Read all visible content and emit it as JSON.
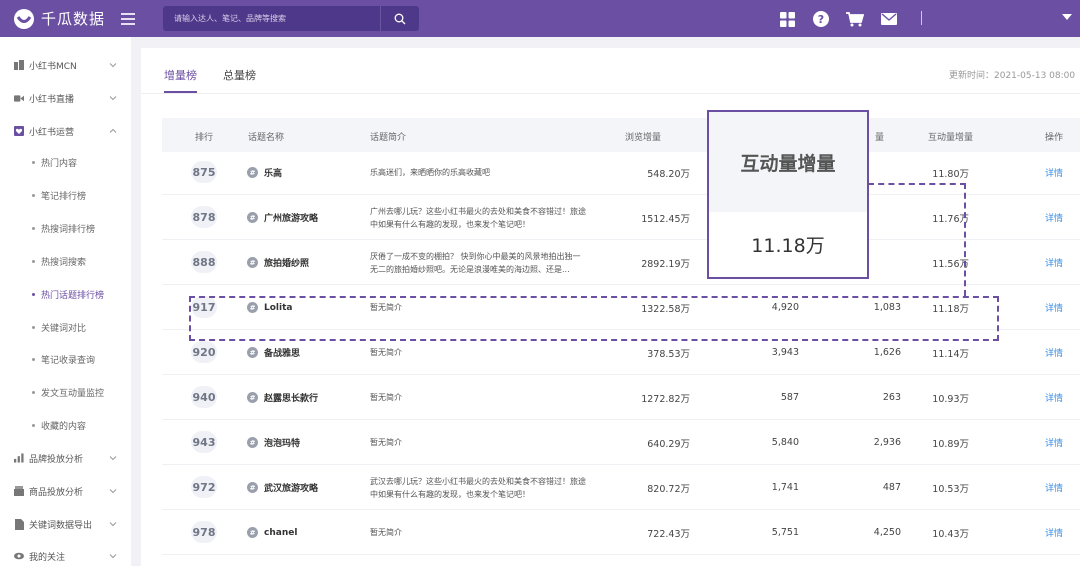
{
  "app": {
    "name": "千瓜数据",
    "search_placeholder": "请输入达人、笔记、品牌等搜索"
  },
  "top_icons": [
    "grid-icon",
    "help-icon",
    "cart-icon",
    "mail-icon"
  ],
  "sidebar": {
    "items": [
      {
        "label": "小红书MCN",
        "icon": "building-icon"
      },
      {
        "label": "小红书直播",
        "icon": "video-icon"
      },
      {
        "label": "小红书运营",
        "icon": "heart-box-icon"
      }
    ],
    "sub_items": [
      {
        "label": "热门内容",
        "active": false
      },
      {
        "label": "笔记排行榜",
        "active": false
      },
      {
        "label": "热搜词排行榜",
        "active": false
      },
      {
        "label": "热搜词搜索",
        "active": false
      },
      {
        "label": "热门话题排行榜",
        "active": true
      },
      {
        "label": "关键词对比",
        "active": false
      },
      {
        "label": "笔记收录查询",
        "active": false
      },
      {
        "label": "发文互动量监控",
        "active": false
      },
      {
        "label": "收藏的内容",
        "active": false
      }
    ],
    "bottom_items": [
      {
        "label": "品牌投放分析",
        "icon": "chart-icon"
      },
      {
        "label": "商品投放分析",
        "icon": "shop-icon"
      },
      {
        "label": "关键词数据导出",
        "icon": "export-icon"
      },
      {
        "label": "我的关注",
        "icon": "eye-icon"
      }
    ]
  },
  "tabs": [
    {
      "label": "增量榜",
      "active": true
    },
    {
      "label": "总量榜",
      "active": false
    }
  ],
  "update_time": "更新时间：2021-05-13 08:00",
  "table": {
    "headers": [
      "排行",
      "话题名称",
      "话题简介",
      "浏览增量",
      "",
      "量",
      "互动量增量",
      "操作"
    ],
    "rows": [
      {
        "rank": "875",
        "topic": "乐高",
        "desc": "乐高迷们，来晒晒你的乐高收藏吧",
        "views": "548.20万",
        "c2": "",
        "c3": "",
        "interact": "11.80万",
        "action": "详情"
      },
      {
        "rank": "878",
        "topic": "广州旅游攻略",
        "desc": "广州去哪儿玩？这些小红书最火的去处和美食不容错过！旅途中如果有什么有趣的发现，也来发个笔记吧！",
        "views": "1512.45万",
        "c2": "",
        "c3": "",
        "interact": "11.76万",
        "action": "详情"
      },
      {
        "rank": "888",
        "topic": "旅拍婚纱照",
        "desc": "厌倦了一成不变的棚拍？ 快到你心中最美的风景地拍出独一无二的旅拍婚纱照吧。无论是浪漫唯美的海边照、还是...",
        "views": "2892.19万",
        "c2": "",
        "c3": "",
        "interact": "11.56万",
        "action": "详情"
      },
      {
        "rank": "917",
        "topic": "Lolita",
        "desc": "暂无简介",
        "views": "1322.58万",
        "c2": "4,920",
        "c3": "1,083",
        "interact": "11.18万",
        "action": "详情"
      },
      {
        "rank": "920",
        "topic": "备战雅思",
        "desc": "暂无简介",
        "views": "378.53万",
        "c2": "3,943",
        "c3": "1,626",
        "interact": "11.14万",
        "action": "详情"
      },
      {
        "rank": "940",
        "topic": "赵露思长款行",
        "desc": "暂无简介",
        "views": "1272.82万",
        "c2": "587",
        "c3": "263",
        "interact": "10.93万",
        "action": "详情"
      },
      {
        "rank": "943",
        "topic": "泡泡玛特",
        "desc": "暂无简介",
        "views": "640.29万",
        "c2": "5,840",
        "c3": "2,936",
        "interact": "10.89万",
        "action": "详情"
      },
      {
        "rank": "972",
        "topic": "武汉旅游攻略",
        "desc": "武汉去哪儿玩？这些小红书最火的去处和美食不容错过！旅途中如果有什么有趣的发现，也来发个笔记吧！",
        "views": "820.72万",
        "c2": "1,741",
        "c3": "487",
        "interact": "10.53万",
        "action": "详情"
      },
      {
        "rank": "978",
        "topic": "chanel",
        "desc": "暂无简介",
        "views": "722.43万",
        "c2": "5,751",
        "c3": "4,250",
        "interact": "10.43万",
        "action": "详情"
      }
    ]
  },
  "callout": {
    "title": "互动量增量",
    "value": "11.18万"
  },
  "colors": {
    "brand": "#6b4fa3",
    "link": "#3a8ee6"
  }
}
